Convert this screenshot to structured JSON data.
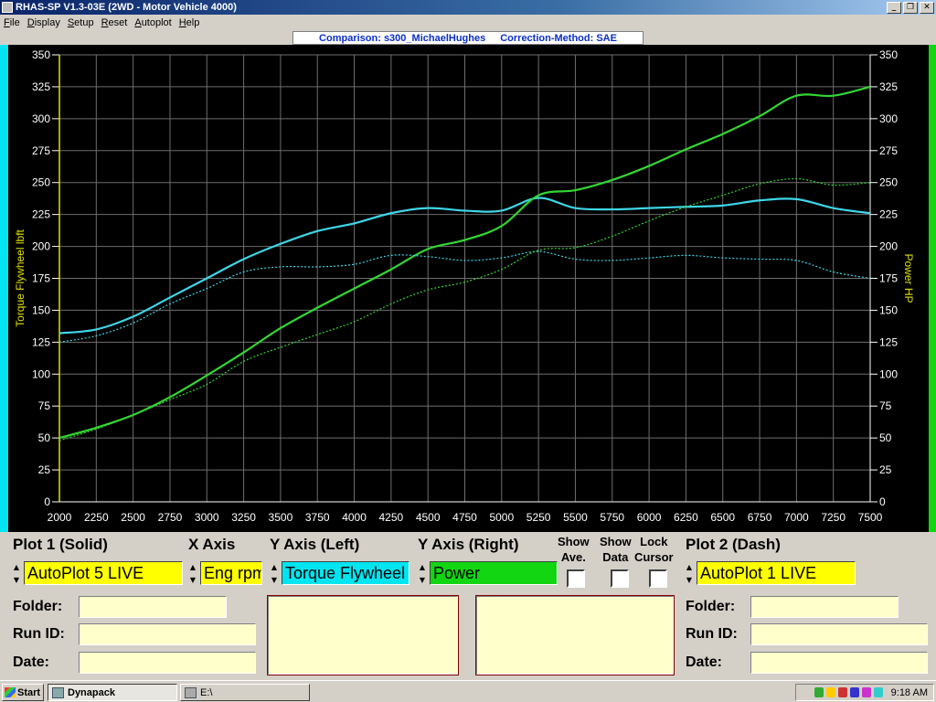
{
  "window": {
    "title": "RHAS-SP V1.3-03E  (2WD - Motor Vehicle 4000)",
    "buttons": {
      "minimize": "_",
      "restore": "❐",
      "close": "✕"
    }
  },
  "menu": [
    "File",
    "Display",
    "Setup",
    "Reset",
    "Autoplot",
    "Help"
  ],
  "header": {
    "comparison": "Comparison: s300_MichaelHughes",
    "correction": "Correction-Method: SAE"
  },
  "chart_data": {
    "type": "line",
    "x": [
      2000,
      2250,
      2500,
      2750,
      3000,
      3250,
      3500,
      3750,
      4000,
      4250,
      4500,
      4750,
      5000,
      5250,
      5500,
      5750,
      6000,
      6250,
      6500,
      6750,
      7000,
      7250,
      7500
    ],
    "xlim": [
      2000,
      7500
    ],
    "x_ticks": [
      "2000",
      "2250",
      "2500",
      "2750",
      "3000",
      "3250",
      "3500",
      "3750",
      "4000",
      "4250",
      "4500",
      "4750",
      "5000",
      "5250",
      "5500",
      "5750",
      "6000",
      "6250",
      "6500",
      "6750",
      "7000",
      "7250",
      "7500"
    ],
    "ylim_left": [
      0,
      350
    ],
    "ylim_right": [
      0,
      350
    ],
    "y_ticks": [
      "0",
      "25",
      "50",
      "75",
      "100",
      "125",
      "150",
      "175",
      "200",
      "225",
      "250",
      "275",
      "300",
      "325",
      "350"
    ],
    "ylabel_left": "Torque Flywheel lbft",
    "ylabel_right": "Power HP",
    "grid": true,
    "series": [
      {
        "name": "Torque Flywheel",
        "axis": "left",
        "style": "solid",
        "color": "#3fd6e8",
        "values": [
          132,
          135,
          145,
          160,
          175,
          190,
          202,
          212,
          218,
          226,
          230,
          228,
          228,
          238,
          230,
          229,
          230,
          231,
          232,
          236,
          237,
          230,
          226
        ]
      },
      {
        "name": "Power",
        "axis": "right",
        "style": "solid",
        "color": "#33d633",
        "values": [
          50,
          58,
          68,
          82,
          99,
          117,
          136,
          152,
          167,
          182,
          198,
          205,
          216,
          240,
          244,
          252,
          263,
          276,
          288,
          302,
          318,
          318,
          325
        ]
      },
      {
        "name": "Torque Flywheel",
        "axis": "left",
        "style": "dash",
        "color": "#3fd6e8",
        "values": [
          125,
          130,
          140,
          155,
          167,
          180,
          184,
          184,
          186,
          193,
          192,
          189,
          191,
          196,
          190,
          189,
          191,
          193,
          191,
          190,
          189,
          180,
          175
        ]
      },
      {
        "name": "Power",
        "axis": "right",
        "style": "dash",
        "color": "#33d633",
        "values": [
          48,
          57,
          68,
          80,
          92,
          110,
          121,
          131,
          141,
          155,
          166,
          172,
          182,
          197,
          199,
          208,
          220,
          231,
          240,
          249,
          253,
          248,
          250
        ]
      }
    ]
  },
  "panel": {
    "plot1_label": "Plot 1 (Solid)",
    "xaxis_label": "X Axis",
    "yleft_label": "Y Axis (Left)",
    "yright_label": "Y Axis (Right)",
    "show_ave_label_1": "Show",
    "show_ave_label_2": "Ave.",
    "show_data_label_1": "Show",
    "show_data_label_2": "Data",
    "lock_cursor_label_1": "Lock",
    "lock_cursor_label_2": "Cursor",
    "plot2_label": "Plot 2 (Dash)",
    "plot1_value": "AutoPlot 5 LIVE",
    "xaxis_value": "Eng rpm",
    "yleft_value": "Torque Flywheel",
    "yright_value": "Power",
    "plot2_value": "AutoPlot 1 LIVE",
    "folder_label": "Folder:",
    "runid_label": "Run ID:",
    "date_label": "Date:",
    "colors": {
      "yellow": "#ffff00",
      "cyan": "#00e5f0",
      "green": "#11d611"
    }
  },
  "taskbar": {
    "start": "Start",
    "task1": "Dynapack",
    "task2": "E:\\",
    "clock": "9:18 AM"
  }
}
